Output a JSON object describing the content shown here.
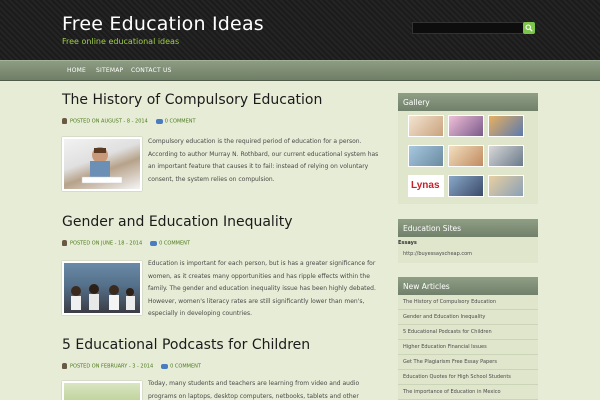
{
  "site": {
    "title": "Free Education Ideas",
    "tagline": "Free online educational ideas"
  },
  "nav": [
    "HOME",
    "SITEMAP",
    "CONTACT US"
  ],
  "posts": [
    {
      "title": "The History of Compulsory Education",
      "meta": "POSTED ON AUGUST - 8 - 2014",
      "comments": "0 COMMENT",
      "excerpt": "Compulsory education is the required period of education for a person. According to author Murray N. Rothbard, our current educational system has an important feature that causes it to fail: instead of relying on voluntary consent, the system relies on compulsion."
    },
    {
      "title": "Gender and Education Inequality",
      "meta": "POSTED ON JUNE - 18 - 2014",
      "comments": "0 COMMENT",
      "excerpt": "Education is important for each person, but is has a greater significance for women, as it creates many opportunities and has ripple effects within the family. The gender and education inequality issue has been highly debated. However, women's literacy rates are still significantly lower than men's, especially in developing countries."
    },
    {
      "title": "5 Educational Podcasts for Children",
      "meta": "POSTED ON FEBRUARY - 3 - 2014",
      "comments": "0 COMMENT",
      "excerpt": "Today, many students and teachers are learning from video and audio programs on laptops, desktop computers, netbooks, tablets and other"
    }
  ],
  "sidebar": {
    "gallery_title": "Gallery",
    "gallery_logo_text": "Lynas",
    "education_sites_title": "Education Sites",
    "essays_label": "Essays",
    "essays_link": "http://buyessayscheap.com",
    "new_articles_title": "New Articles",
    "new_articles": [
      "The History of Compulsory Education",
      "Gender and Education Inequality",
      "5 Educational Podcasts for Children",
      "Higher Education Financial Issues",
      "Get The Plagiarism Free Essay Papers",
      "Education Quotes for High School Students",
      "The importance of Education in Mexico"
    ]
  }
}
